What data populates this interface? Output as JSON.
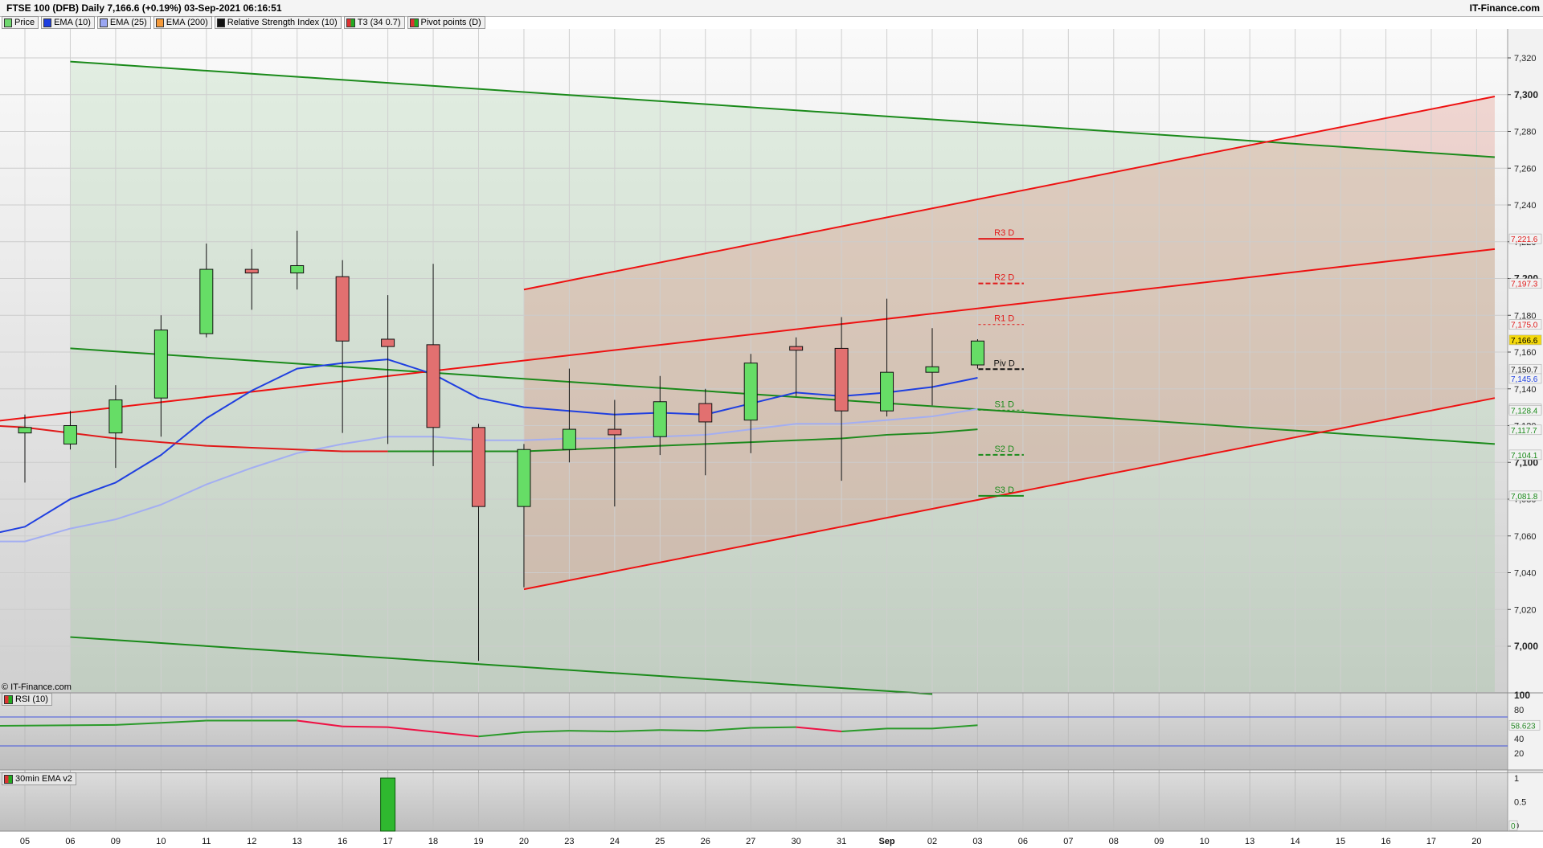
{
  "header": {
    "title": "FTSE 100 (DFB) Daily 7,166.6 (+0.19%) 03-Sep-2021 06:16:51",
    "brand": "IT-Finance.com",
    "copyright": "© IT-Finance.com"
  },
  "legend": [
    {
      "label": "Price",
      "color": "#6fd86f"
    },
    {
      "label": "EMA (10)",
      "color": "#1f3fe0"
    },
    {
      "label": "EMA (25)",
      "color": "#9aa6f2"
    },
    {
      "label": "EMA (200)",
      "color": "#f59a3a"
    },
    {
      "label": "Relative Strength Index (10)",
      "color": "#111111"
    },
    {
      "label": "T3 (34 0.7)",
      "color": "split"
    },
    {
      "label": "Pivot points (D)",
      "color": "split"
    }
  ],
  "panes": {
    "rsi_label": "RSI (10)",
    "ema30_label": "30min EMA v2"
  },
  "colors": {
    "bull": "#66dd66",
    "bear": "#e27070",
    "ema10": "#1f3fe0",
    "ema25": "#a3aef2",
    "t3_up": "#1e8a1e",
    "t3_down": "#e01a1a",
    "channel_green": "#1a8a1a",
    "channel_red": "#ee1111",
    "resistance": "#e01a1a",
    "support": "#1a8a1a"
  },
  "chart_data": [
    {
      "type": "candlestick",
      "title": "FTSE 100 (DFB) Daily",
      "ylim": [
        6975,
        7335
      ],
      "y_ticks": [
        7000,
        7020,
        7040,
        7060,
        7080,
        7100,
        7120,
        7140,
        7160,
        7180,
        7200,
        7220,
        7240,
        7260,
        7280,
        7300,
        7320
      ],
      "y_ticks_major": [
        7000,
        7100,
        7200,
        7300
      ],
      "x_ticks": [
        "05",
        "06",
        "09",
        "10",
        "11",
        "12",
        "13",
        "16",
        "17",
        "18",
        "19",
        "20",
        "23",
        "24",
        "25",
        "26",
        "27",
        "30",
        "31",
        "Sep",
        "02",
        "03",
        "06",
        "07",
        "08",
        "09",
        "10",
        "13",
        "14",
        "15",
        "16",
        "17",
        "20"
      ],
      "candles": [
        {
          "x": "05",
          "open": 7116,
          "high": 7126,
          "low": 7089,
          "close": 7119
        },
        {
          "x": "06",
          "open": 7110,
          "high": 7128,
          "low": 7107,
          "close": 7120
        },
        {
          "x": "09",
          "open": 7116,
          "high": 7142,
          "low": 7097,
          "close": 7134
        },
        {
          "x": "10",
          "open": 7135,
          "high": 7180,
          "low": 7114,
          "close": 7172
        },
        {
          "x": "11",
          "open": 7170,
          "high": 7219,
          "low": 7168,
          "close": 7205
        },
        {
          "x": "12",
          "open": 7205,
          "high": 7216,
          "low": 7183,
          "close": 7203
        },
        {
          "x": "13",
          "open": 7203,
          "high": 7226,
          "low": 7194,
          "close": 7207
        },
        {
          "x": "16",
          "open": 7201,
          "high": 7210,
          "low": 7116,
          "close": 7166
        },
        {
          "x": "17",
          "open": 7167,
          "high": 7191,
          "low": 7110,
          "close": 7163
        },
        {
          "x": "18",
          "open": 7164,
          "high": 7208,
          "low": 7098,
          "close": 7119
        },
        {
          "x": "19",
          "open": 7119,
          "high": 7121,
          "low": 6992,
          "close": 7076
        },
        {
          "x": "20",
          "open": 7076,
          "high": 7110,
          "low": 7032,
          "close": 7107
        },
        {
          "x": "23",
          "open": 7107,
          "high": 7151,
          "low": 7100,
          "close": 7118
        },
        {
          "x": "24",
          "open": 7118,
          "high": 7134,
          "low": 7076,
          "close": 7115
        },
        {
          "x": "25",
          "open": 7114,
          "high": 7147,
          "low": 7104,
          "close": 7133
        },
        {
          "x": "26",
          "open": 7132,
          "high": 7140,
          "low": 7093,
          "close": 7122
        },
        {
          "x": "27",
          "open": 7123,
          "high": 7159,
          "low": 7105,
          "close": 7154
        },
        {
          "x": "30",
          "open": 7163,
          "high": 7168,
          "low": 7136,
          "close": 7161
        },
        {
          "x": "31",
          "open": 7162,
          "high": 7179,
          "low": 7090,
          "close": 7128
        },
        {
          "x": "Sep",
          "open": 7128,
          "high": 7189,
          "low": 7125,
          "close": 7149
        },
        {
          "x": "02",
          "open": 7149,
          "high": 7173,
          "low": 7131,
          "close": 7152
        },
        {
          "x": "03",
          "open": 7153,
          "high": 7167,
          "low": 7151,
          "close": 7166
        }
      ],
      "ema10": [
        [
          0,
          7065
        ],
        [
          1,
          7080
        ],
        [
          2,
          7089
        ],
        [
          3,
          7104
        ],
        [
          4,
          7124
        ],
        [
          5,
          7139
        ],
        [
          6,
          7151
        ],
        [
          7,
          7154
        ],
        [
          8,
          7156
        ],
        [
          9,
          7148
        ],
        [
          10,
          7135
        ],
        [
          11,
          7130
        ],
        [
          12,
          7128
        ],
        [
          13,
          7126
        ],
        [
          14,
          7127
        ],
        [
          15,
          7126
        ],
        [
          16,
          7132
        ],
        [
          17,
          7138
        ],
        [
          18,
          7136
        ],
        [
          19,
          7138
        ],
        [
          20,
          7141
        ],
        [
          21,
          7146
        ]
      ],
      "ema25": [
        [
          0,
          7057
        ],
        [
          1,
          7064
        ],
        [
          2,
          7069
        ],
        [
          3,
          7077
        ],
        [
          4,
          7088
        ],
        [
          5,
          7097
        ],
        [
          6,
          7105
        ],
        [
          7,
          7110
        ],
        [
          8,
          7114
        ],
        [
          9,
          7114
        ],
        [
          10,
          7112
        ],
        [
          11,
          7112
        ],
        [
          12,
          7113
        ],
        [
          13,
          7113
        ],
        [
          14,
          7114
        ],
        [
          15,
          7115
        ],
        [
          16,
          7118
        ],
        [
          17,
          7121
        ],
        [
          18,
          7121
        ],
        [
          19,
          7123
        ],
        [
          20,
          7125
        ],
        [
          21,
          7129
        ]
      ],
      "t3_down": [
        [
          0,
          7119
        ],
        [
          1,
          7116
        ],
        [
          2,
          7113
        ],
        [
          3,
          7111
        ],
        [
          4,
          7109
        ],
        [
          5,
          7108
        ],
        [
          6,
          7107
        ],
        [
          7,
          7106
        ],
        [
          8,
          7106
        ]
      ],
      "t3_up": [
        [
          8,
          7106
        ],
        [
          9,
          7106
        ],
        [
          10,
          7106
        ],
        [
          11,
          7106
        ],
        [
          12,
          7107
        ],
        [
          13,
          7108
        ],
        [
          14,
          7109
        ],
        [
          15,
          7110
        ],
        [
          16,
          7111
        ],
        [
          17,
          7112
        ],
        [
          18,
          7113
        ],
        [
          19,
          7115
        ],
        [
          20,
          7116
        ],
        [
          21,
          7118
        ]
      ],
      "green_channel": {
        "upper": [
          [
            1,
            7318
          ],
          [
            32.4,
            7266
          ]
        ],
        "middle": [
          [
            1,
            7162
          ],
          [
            32.4,
            7110
          ]
        ],
        "lower": [
          [
            1,
            7005
          ],
          [
            20,
            6974
          ]
        ]
      },
      "red_channel": {
        "upper": [
          [
            11,
            7194
          ],
          [
            32.4,
            7299
          ]
        ],
        "middle": [
          [
            -1.5,
            7120
          ],
          [
            32.4,
            7216
          ]
        ],
        "lower": [
          [
            11,
            7031
          ],
          [
            32.4,
            7135
          ]
        ]
      },
      "pivot_points": [
        {
          "label": "R3 D",
          "value": 7221.6,
          "style": "solid",
          "color": "#e01a1a"
        },
        {
          "label": "R2 D",
          "value": 7197.3,
          "style": "dashed",
          "color": "#e01a1a"
        },
        {
          "label": "R1 D",
          "value": 7175.0,
          "style": "dashed-thin",
          "color": "#e01a1a"
        },
        {
          "label": "Piv D",
          "value": 7150.7,
          "style": "dashed",
          "color": "#111111"
        },
        {
          "label": "S1 D",
          "value": 7128.4,
          "style": "dashed-thin",
          "color": "#1a8a1a"
        },
        {
          "label": "S2 D",
          "value": 7104.1,
          "style": "dashed",
          "color": "#1a8a1a"
        },
        {
          "label": "S3 D",
          "value": 7081.8,
          "style": "solid",
          "color": "#1a8a1a"
        }
      ],
      "price_tags": [
        {
          "text": "7,221.6",
          "value": 7221.6,
          "bg": "#f2f2f2",
          "fg": "#e01a1a"
        },
        {
          "text": "7,197.3",
          "value": 7197.3,
          "bg": "#f2f2f2",
          "fg": "#e01a1a"
        },
        {
          "text": "7,175.0",
          "value": 7175.0,
          "bg": "#f2f2f2",
          "fg": "#e01a1a"
        },
        {
          "text": "7,166.6",
          "value": 7166.6,
          "bg": "#f5d90a",
          "fg": "#000000"
        },
        {
          "text": "7,150.7",
          "value": 7150.7,
          "bg": "#f2f2f2",
          "fg": "#111111"
        },
        {
          "text": "7,145.6",
          "value": 7145.6,
          "bg": "#f2f2f2",
          "fg": "#1f3fe0"
        },
        {
          "text": "7,129.1",
          "value": 7129.1,
          "bg": "#f2f2f2",
          "fg": "#8f9af0"
        },
        {
          "text": "7,128.4",
          "value": 7128.4,
          "bg": "#f2f2f2",
          "fg": "#1a8a1a"
        },
        {
          "text": "7,117.7",
          "value": 7117.7,
          "bg": "#f2f2f2",
          "fg": "#1a8a1a"
        },
        {
          "text": "7,104.1",
          "value": 7104.1,
          "bg": "#f2f2f2",
          "fg": "#1a8a1a"
        },
        {
          "text": "7,081.8",
          "value": 7081.8,
          "bg": "#f2f2f2",
          "fg": "#1a8a1a"
        }
      ]
    },
    {
      "type": "line",
      "title": "RSI (10)",
      "ylim": [
        0,
        100
      ],
      "y_ticks": [
        100,
        80,
        60,
        40,
        20
      ],
      "levels": [
        70,
        30
      ],
      "values": [
        [
          0,
          58
        ],
        [
          2,
          59
        ],
        [
          3,
          62
        ],
        [
          4,
          65
        ],
        [
          5,
          65
        ],
        [
          6,
          65
        ],
        [
          7,
          57
        ],
        [
          8,
          56
        ],
        [
          10,
          43
        ],
        [
          11,
          49
        ],
        [
          12,
          51
        ],
        [
          13,
          50
        ],
        [
          14,
          52
        ],
        [
          15,
          51
        ],
        [
          16,
          55
        ],
        [
          17,
          56
        ],
        [
          18,
          50
        ],
        [
          19,
          54
        ],
        [
          20,
          54
        ],
        [
          21,
          58.6
        ]
      ],
      "last_value": "58.623",
      "colors": [
        "#2a9a2a",
        "#ee1144"
      ]
    },
    {
      "type": "bar",
      "title": "30min EMA v2",
      "ylim": [
        0,
        1
      ],
      "y_ticks": [
        "1",
        "0.5",
        "0"
      ],
      "bars": [
        {
          "x": "17",
          "value": 1
        }
      ],
      "last_value": "0"
    }
  ]
}
